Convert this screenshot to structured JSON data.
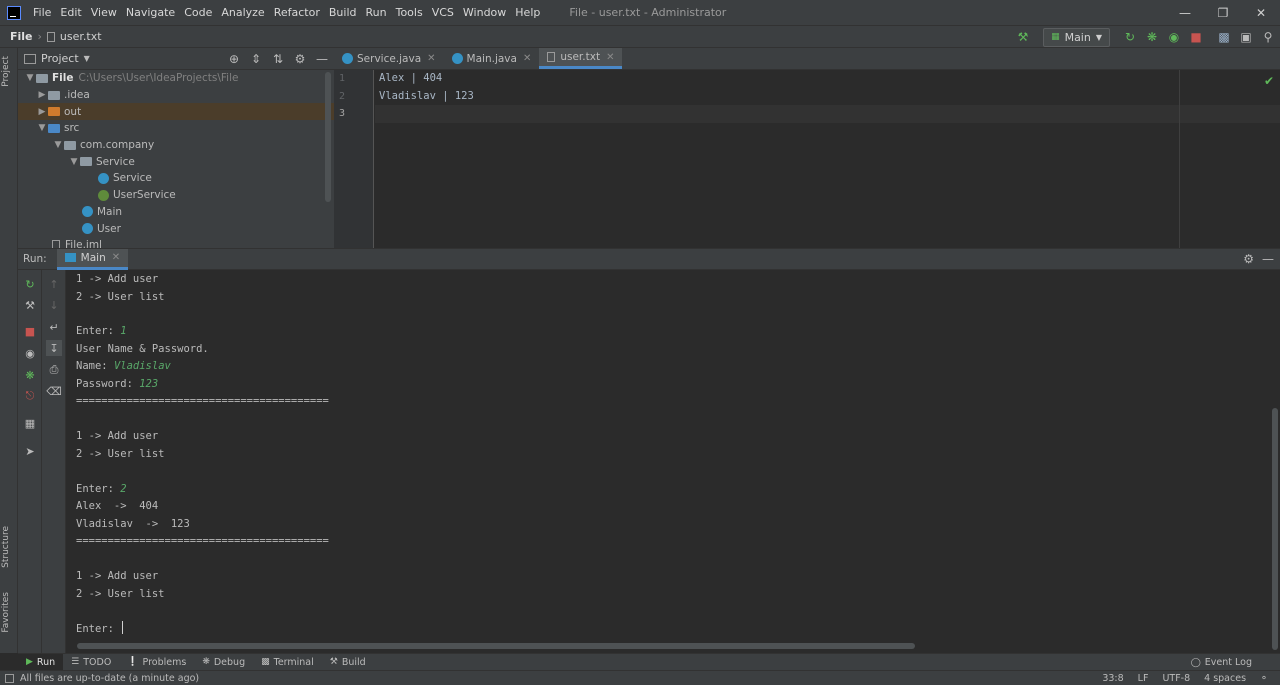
{
  "menu": {
    "items": [
      "File",
      "Edit",
      "View",
      "Navigate",
      "Code",
      "Analyze",
      "Refactor",
      "Build",
      "Run",
      "Tools",
      "VCS",
      "Window",
      "Help"
    ],
    "window_title": "File - user.txt - Administrator"
  },
  "nav": {
    "project": "File",
    "file": "user.txt",
    "run_config": "Main"
  },
  "left_stripe": {
    "project": "Project",
    "structure": "Structure",
    "favorites": "Favorites"
  },
  "project_panel": {
    "title": "Project",
    "tree": {
      "root": "File",
      "root_path": "C:\\Users\\User\\IdeaProjects\\File",
      "idea": ".idea",
      "out": "out",
      "src": "src",
      "com_company": "com.company",
      "service_pkg": "Service",
      "service_class": "Service",
      "userservice": "UserService",
      "main": "Main",
      "user": "User",
      "file_iml": "File.iml"
    }
  },
  "editor": {
    "tabs": [
      "Service.java",
      "Main.java",
      "user.txt"
    ],
    "line_numbers": [
      "1",
      "2",
      "3"
    ],
    "lines": [
      "Alex | 404",
      "Vladislav | 123",
      ""
    ]
  },
  "run": {
    "label": "Run:",
    "tab": "Main",
    "console": {
      "l1": "1 -> Add user",
      "l2": "2 -> User list",
      "l3_prompt": "Enter: ",
      "l3_input": "1",
      "l4": "User Name & Password.",
      "l5_prompt": "Name: ",
      "l5_input": "Vladislav",
      "l6_prompt": "Password: ",
      "l6_input": "123",
      "sep1": "========================================",
      "l7": "1 -> Add user",
      "l8": "2 -> User list",
      "l9_prompt": "Enter: ",
      "l9_input": "2",
      "l10": "Alex  ->  404",
      "l11": "Vladislav  ->  123",
      "sep2": "========================================",
      "l12": "1 -> Add user",
      "l13": "2 -> User list",
      "l14_prompt": "Enter: "
    }
  },
  "tool_tabs": {
    "run": "Run",
    "todo": "TODO",
    "problems": "Problems",
    "debug": "Debug",
    "terminal": "Terminal",
    "build": "Build",
    "event_log": "Event Log"
  },
  "status": {
    "message": "All files are up-to-date (a minute ago)",
    "position": "33:8",
    "line_sep": "LF",
    "encoding": "UTF-8",
    "indent": "4 spaces"
  },
  "colors": {
    "accent": "#4a88c7",
    "console_input": "#59a869",
    "run_icon": "#5fb95a",
    "stop_icon": "#c75450"
  }
}
